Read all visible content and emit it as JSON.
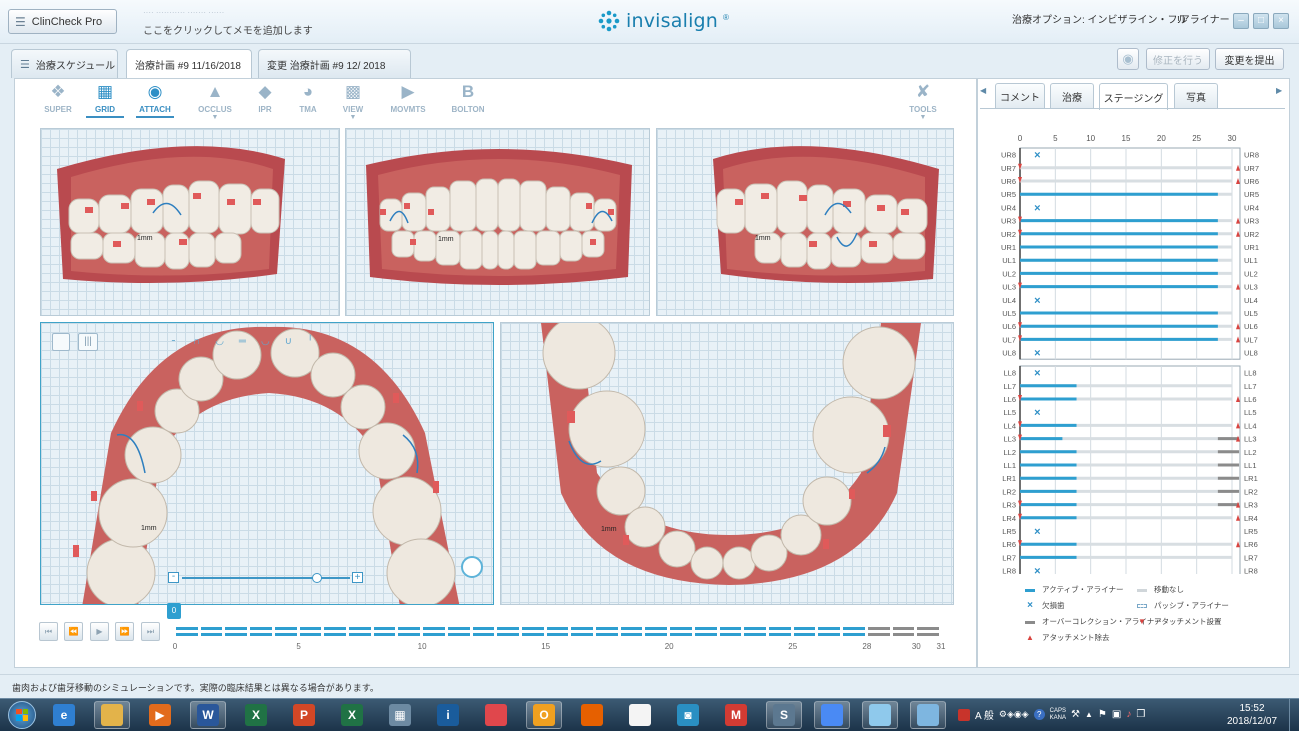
{
  "window": {
    "app_button": "ClinCheck Pro",
    "note_hint": "ここをクリックしてメモを追加します",
    "brand": "invisalign",
    "treatment_option": "治療オプション: インビザライン・フル",
    "user": "!アライナー"
  },
  "tabs": [
    {
      "label": "治療スケジュール"
    },
    {
      "label": "治療計画 #9 11/16/2018"
    },
    {
      "label": "変更 治療計画 #9 12/   2018"
    }
  ],
  "actions": {
    "modify": "修正を行う",
    "submit": "変更を提出"
  },
  "toolbar": [
    {
      "label": "SUPER",
      "icon": "super-icon",
      "state": "normal"
    },
    {
      "label": "GRID",
      "icon": "grid-icon",
      "state": "selected"
    },
    {
      "label": "ATTACH",
      "icon": "attach-icon",
      "state": "selected"
    },
    {
      "label": "OCCLUS",
      "icon": "occlus-icon",
      "state": "dropdown"
    },
    {
      "label": "IPR",
      "icon": "ipr-icon",
      "state": "normal"
    },
    {
      "label": "TMA",
      "icon": "tma-icon",
      "state": "normal"
    },
    {
      "label": "VIEW",
      "icon": "view-icon",
      "state": "dropdown"
    },
    {
      "label": "MOVMTS",
      "icon": "movmts-icon",
      "state": "normal"
    },
    {
      "label": "BOLTON",
      "icon": "bolton-icon",
      "state": "normal"
    },
    {
      "label": "TOOLS",
      "icon": "tools-icon",
      "state": "dropdown"
    }
  ],
  "views": {
    "measure_label": "1mm"
  },
  "timeline": {
    "current_stage": "0",
    "active_stages": 28,
    "total_stages": 31,
    "ticks": [
      "0",
      "5",
      "10",
      "15",
      "20",
      "25",
      "28",
      "30",
      "31"
    ]
  },
  "right_tabs": [
    {
      "label": "コメント"
    },
    {
      "label": "治療"
    },
    {
      "label": "ステージング"
    },
    {
      "label": "写真"
    }
  ],
  "staging": {
    "axis": [
      "0",
      "5",
      "10",
      "15",
      "20",
      "25",
      "30"
    ],
    "upper": [
      {
        "tooth": "UR8",
        "missing": true
      },
      {
        "tooth": "UR7",
        "att_left": true,
        "att_right": true
      },
      {
        "tooth": "UR6",
        "att_left": true,
        "att_right": true
      },
      {
        "tooth": "UR5",
        "active": 28
      },
      {
        "tooth": "UR4",
        "missing": true
      },
      {
        "tooth": "UR3",
        "active": 28,
        "att_left": true,
        "att_right": true
      },
      {
        "tooth": "UR2",
        "active": 28,
        "att_left": true,
        "att_right": true
      },
      {
        "tooth": "UR1",
        "active": 28
      },
      {
        "tooth": "UL1",
        "active": 28
      },
      {
        "tooth": "UL2",
        "active": 28
      },
      {
        "tooth": "UL3",
        "active": 28,
        "att_left": true,
        "att_right": true
      },
      {
        "tooth": "UL4",
        "missing": true
      },
      {
        "tooth": "UL5",
        "active": 28
      },
      {
        "tooth": "UL6",
        "active": 28,
        "att_left": true,
        "att_right": true
      },
      {
        "tooth": "UL7",
        "active": 28,
        "att_left": true,
        "att_right": true
      },
      {
        "tooth": "UL8",
        "missing": true
      }
    ],
    "lower": [
      {
        "tooth": "LL8",
        "missing": true
      },
      {
        "tooth": "LL7",
        "active": 8
      },
      {
        "tooth": "LL6",
        "active": 8,
        "att_left": true,
        "att_right": true
      },
      {
        "tooth": "LL5",
        "missing": true
      },
      {
        "tooth": "LL4",
        "active": 8,
        "att_left": true,
        "att_right": true
      },
      {
        "tooth": "LL3",
        "active": 6,
        "overcorrect": true,
        "att_left": true,
        "att_right": true
      },
      {
        "tooth": "LL2",
        "active": 8,
        "overcorrect": true
      },
      {
        "tooth": "LL1",
        "active": 8,
        "overcorrect": true
      },
      {
        "tooth": "LR1",
        "active": 8,
        "overcorrect": true
      },
      {
        "tooth": "LR2",
        "active": 8,
        "overcorrect": true
      },
      {
        "tooth": "LR3",
        "active": 8,
        "overcorrect": true,
        "att_left": true,
        "att_right": true
      },
      {
        "tooth": "LR4",
        "active": 8,
        "att_left": true,
        "att_right": true
      },
      {
        "tooth": "LR5",
        "missing": true
      },
      {
        "tooth": "LR6",
        "active": 8,
        "att_left": true,
        "att_right": true
      },
      {
        "tooth": "LR7",
        "active": 8
      },
      {
        "tooth": "LR8",
        "missing": true
      }
    ],
    "legend": [
      {
        "label": "アクティブ・アライナー",
        "icon": "active-aligner-icon"
      },
      {
        "label": "移動なし",
        "icon": "no-movement-icon"
      },
      {
        "label": "欠損歯",
        "icon": "missing-tooth-icon"
      },
      {
        "label": "パッシブ・アライナー",
        "icon": "passive-aligner-icon"
      },
      {
        "label": "オーバーコレクション・アライナー",
        "icon": "overcorrection-icon"
      },
      {
        "label": "アタッチメント設置",
        "icon": "attachment-place-icon"
      },
      {
        "label": "アタッチメント除去",
        "icon": "attachment-remove-icon"
      }
    ]
  },
  "status_text": "歯肉および歯牙移動のシミュレーションです。実際の臨床結果とは異なる場合があります。",
  "taskbar": {
    "apps": [
      "ie-icon",
      "explorer-icon",
      "media-player-icon",
      "word-icon",
      "excel-icon",
      "powerpoint-icon",
      "excel-icon",
      "calculator-icon",
      "invisalign-icon",
      "photo-icon",
      "outlook-icon",
      "firefox-icon",
      "tooth-icon",
      "camera-icon",
      "mail-icon",
      "sketch-icon",
      "chrome-icon",
      "clincheck-icon",
      "paint-icon"
    ],
    "ime": "A 般",
    "caps": "CAPS",
    "kana": "KANA",
    "time": "15:52",
    "date": "2018/12/07"
  },
  "colors": {
    "accent": "#2e9fd0",
    "gum": "#b94a4f",
    "attachment": "#e05a5a",
    "overcorrection": "#8b8b8b"
  }
}
